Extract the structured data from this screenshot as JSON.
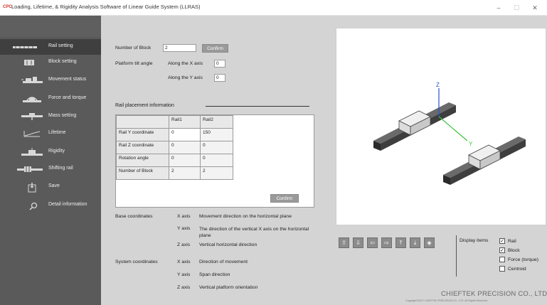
{
  "window": {
    "logo": "CPC",
    "title": "Loading, Lifetime, & Rigidity Analysis Software of Linear Guide System (LLRAS)",
    "minimize": "–",
    "maximize": "☐",
    "close": "✕"
  },
  "sidebar": {
    "items": [
      {
        "label": "Rail setting",
        "icon": "rail-icon",
        "active": true
      },
      {
        "label": "Block setting",
        "icon": "block-icon",
        "active": false
      },
      {
        "label": "Movement status",
        "icon": "movement-icon",
        "active": false
      },
      {
        "label": "Force and torque",
        "icon": "force-icon",
        "active": false
      },
      {
        "label": "Mass setting",
        "icon": "mass-icon",
        "active": false
      },
      {
        "label": "Lifetime",
        "icon": "lifetime-chart-icon",
        "active": false
      },
      {
        "label": "Rigidity",
        "icon": "rigidity-icon",
        "active": false
      },
      {
        "label": "Shifting rail",
        "icon": "shifting-rail-icon",
        "active": false
      },
      {
        "label": "Save",
        "icon": "save-icon",
        "active": false
      },
      {
        "label": "Detail information",
        "icon": "magnifier-icon",
        "active": false
      }
    ]
  },
  "settings": {
    "number_of_block_label": "Number of Block",
    "number_of_block_value": "2",
    "confirm_label": "Confirm",
    "tilt_label": "Platform tilt angle",
    "along_x_label": "Along the X axis",
    "along_x_value": "0",
    "along_y_label": "Along the Y axis",
    "along_y_value": "0"
  },
  "rail_placement": {
    "title": "Rail placement information",
    "columns": [
      "Rail1",
      "Rail2"
    ],
    "rows": [
      {
        "label": "Rail Y coordinate",
        "values": [
          "0",
          "150"
        ]
      },
      {
        "label": "Rail Z coordinate",
        "values": [
          "0",
          "0"
        ]
      },
      {
        "label": "Rotation angle",
        "values": [
          "0",
          "0"
        ]
      },
      {
        "label": "Number of Block",
        "values": [
          "2",
          "2"
        ]
      }
    ],
    "confirm_label": "Confirm"
  },
  "base_coordinates": {
    "title": "Base coordinates",
    "items": [
      {
        "axis": "X axis",
        "desc": "Movement direction on the horizontal plane"
      },
      {
        "axis": "Y axis",
        "desc": "The direction of the vertical X axis on the horizontal plane"
      },
      {
        "axis": "Z axis",
        "desc": "Vertical horizontal direction"
      }
    ]
  },
  "system_coordinates": {
    "title": "System coordinates",
    "items": [
      {
        "axis": "X axis",
        "desc": "Direction of movement"
      },
      {
        "axis": "Y axis",
        "desc": "Span direction"
      },
      {
        "axis": "Z axis",
        "desc": "Vertical platform orientation"
      }
    ]
  },
  "view": {
    "axis_z": "Z",
    "axis_y": "Y",
    "colors": {
      "z_axis": "#2a4fd6",
      "y_axis": "#3cc43c"
    },
    "toolbar": [
      {
        "icon": "arrow-up-icon",
        "glyph": "⇧"
      },
      {
        "icon": "arrow-down-icon",
        "glyph": "⇩"
      },
      {
        "icon": "arrow-left-icon",
        "glyph": "⇦"
      },
      {
        "icon": "arrow-right-icon",
        "glyph": "⇨"
      },
      {
        "icon": "zoom-in-icon",
        "glyph": "⤒"
      },
      {
        "icon": "zoom-out-icon",
        "glyph": "⤓"
      },
      {
        "icon": "reset-view-icon",
        "glyph": "◈"
      }
    ],
    "display_items_label": "Display items",
    "display_items": [
      {
        "label": "Rail",
        "checked": true
      },
      {
        "label": "Block",
        "checked": true
      },
      {
        "label": "Force (torque)",
        "checked": false
      },
      {
        "label": "Centroid",
        "checked": false
      }
    ]
  },
  "footer": {
    "company": "CHIEFTEK PRECISION CO., LTD.",
    "copyright": "Copyright©2017 CHIEFTEK PRECISION CO., LTD. All Rights Reserved."
  }
}
